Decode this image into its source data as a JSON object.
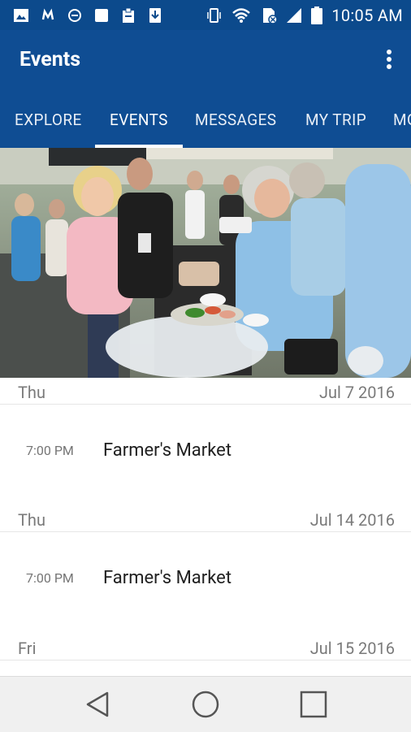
{
  "status_bar": {
    "time": "10:05 AM",
    "icons": [
      "image-icon",
      "m-icon",
      "record-icon",
      "square-icon",
      "clipboard-icon",
      "download-icon",
      "vibrate-icon",
      "wifi-icon",
      "sim-icon",
      "signal-icon",
      "battery-icon"
    ]
  },
  "app_bar": {
    "title": "Events",
    "menu_icon": "more-vert-icon"
  },
  "tabs": [
    {
      "label": "EXPLORE",
      "active": false
    },
    {
      "label": "EVENTS",
      "active": true
    },
    {
      "label": "MESSAGES",
      "active": false
    },
    {
      "label": "MY TRIP",
      "active": false
    },
    {
      "label": "MO",
      "active": false
    }
  ],
  "hero": {
    "description": "Farmer's Market photo"
  },
  "events": [
    {
      "day": "Thu",
      "date": "Jul 7 2016",
      "items": [
        {
          "time": "7:00 PM",
          "name": "Farmer's Market"
        }
      ]
    },
    {
      "day": "Thu",
      "date": "Jul 14 2016",
      "items": [
        {
          "time": "7:00 PM",
          "name": "Farmer's Market"
        }
      ]
    },
    {
      "day": "Fri",
      "date": "Jul 15 2016",
      "items": []
    }
  ],
  "nav_bar": {
    "icons": [
      "back-icon",
      "home-icon",
      "recents-icon"
    ]
  },
  "colors": {
    "primary": "#0f4d93",
    "status": "#0c4a8c",
    "indicator": "#ffffff"
  }
}
